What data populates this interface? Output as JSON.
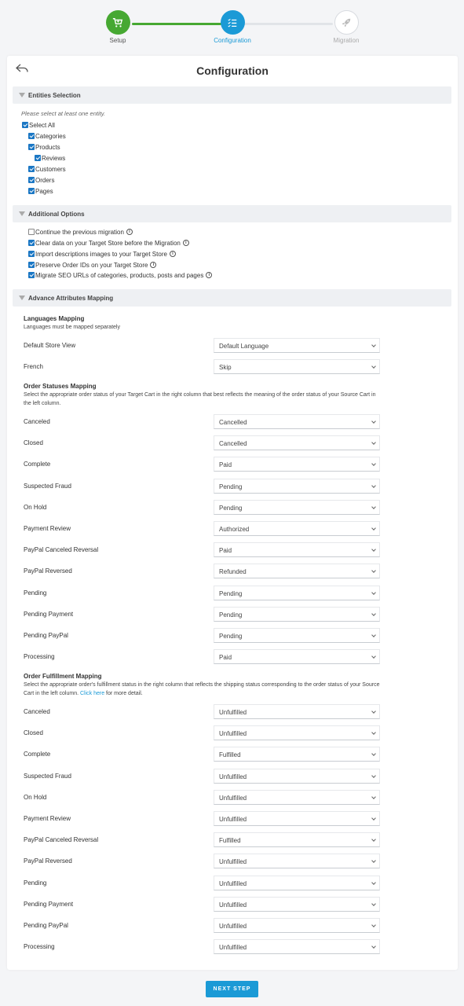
{
  "stepper": {
    "steps": [
      {
        "label": "Setup",
        "state": "done"
      },
      {
        "label": "Configuration",
        "state": "active"
      },
      {
        "label": "Migration",
        "state": "upcoming"
      }
    ]
  },
  "page": {
    "title": "Configuration"
  },
  "entities": {
    "heading": "Entities Selection",
    "hint": "Please select at least one entity.",
    "select_all": "Select All",
    "items": [
      "Categories",
      "Products",
      "Reviews",
      "Customers",
      "Orders",
      "Pages"
    ]
  },
  "additional": {
    "heading": "Additional Options",
    "options": [
      {
        "label": "Continue the previous migration",
        "checked": false
      },
      {
        "label": "Clear data on your Target Store before the Migration",
        "checked": true
      },
      {
        "label": "Import descriptions images to your Target Store",
        "checked": true
      },
      {
        "label": "Preserve Order IDs on your Target Store",
        "checked": true
      },
      {
        "label": "Migrate SEO URLs of categories, products, posts and pages",
        "checked": true
      }
    ]
  },
  "advance": {
    "heading": "Advance Attributes Mapping",
    "languages": {
      "title": "Languages Mapping",
      "desc": "Languages must be mapped separately",
      "rows": [
        {
          "label": "Default Store View",
          "value": "Default Language"
        },
        {
          "label": "French",
          "value": "Skip"
        }
      ]
    },
    "statuses": {
      "title": "Order Statuses Mapping",
      "desc": "Select the appropriate order status of your Target Cart in the right column that best reflects the meaning of the order status of your Source Cart in the left column.",
      "rows": [
        {
          "label": "Canceled",
          "value": "Cancelled"
        },
        {
          "label": "Closed",
          "value": "Cancelled"
        },
        {
          "label": "Complete",
          "value": "Paid"
        },
        {
          "label": "Suspected Fraud",
          "value": "Pending"
        },
        {
          "label": "On Hold",
          "value": "Pending"
        },
        {
          "label": "Payment Review",
          "value": "Authorized"
        },
        {
          "label": "PayPal Canceled Reversal",
          "value": "Paid"
        },
        {
          "label": "PayPal Reversed",
          "value": "Refunded"
        },
        {
          "label": "Pending",
          "value": "Pending"
        },
        {
          "label": "Pending Payment",
          "value": "Pending"
        },
        {
          "label": "Pending PayPal",
          "value": "Pending"
        },
        {
          "label": "Processing",
          "value": "Paid"
        }
      ]
    },
    "fulfillment": {
      "title": "Order Fulfillment Mapping",
      "desc_before": "Select the appropriate order's fulfillment status in the right column that reflects the shipping status corresponding to the order status of your Source Cart in the left column. ",
      "link": "Click here",
      "desc_after": " for more detail.",
      "rows": [
        {
          "label": "Canceled",
          "value": "Unfulfilled"
        },
        {
          "label": "Closed",
          "value": "Unfulfilled"
        },
        {
          "label": "Complete",
          "value": "Fulfilled"
        },
        {
          "label": "Suspected Fraud",
          "value": "Unfulfilled"
        },
        {
          "label": "On Hold",
          "value": "Unfulfilled"
        },
        {
          "label": "Payment Review",
          "value": "Unfulfilled"
        },
        {
          "label": "PayPal Canceled Reversal",
          "value": "Fulfilled"
        },
        {
          "label": "PayPal Reversed",
          "value": "Unfulfilled"
        },
        {
          "label": "Pending",
          "value": "Unfulfilled"
        },
        {
          "label": "Pending Payment",
          "value": "Unfulfilled"
        },
        {
          "label": "Pending PayPal",
          "value": "Unfulfilled"
        },
        {
          "label": "Processing",
          "value": "Unfulfilled"
        }
      ]
    }
  },
  "footer": {
    "next_label": "NEXT STEP"
  },
  "colors": {
    "green": "#46a832",
    "blue": "#1b9ad6",
    "checkbox": "#1b77c4"
  }
}
